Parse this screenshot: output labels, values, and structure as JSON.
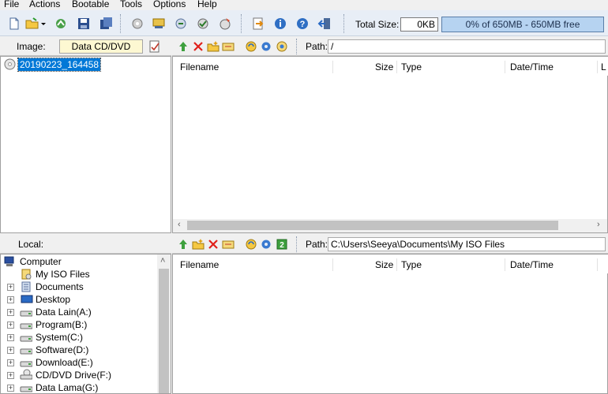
{
  "menu": [
    "File",
    "Actions",
    "Bootable",
    "Tools",
    "Options",
    "Help"
  ],
  "toolbar": {
    "total_size_label": "Total Size:",
    "total_size_value": "0KB",
    "capacity_text": "0% of 650MB - 650MB free",
    "capacity_used_fraction": 0.0
  },
  "image_pane": {
    "label": "Image:",
    "media_type": "Data CD/DVD",
    "root_item": "20190223_164458",
    "path_label": "Path:",
    "path_value": "/",
    "columns": [
      "Filename",
      "Size",
      "Type",
      "Date/Time",
      "L"
    ]
  },
  "local_pane": {
    "label": "Local:",
    "path_label": "Path:",
    "path_value": "C:\\Users\\Seeya\\Documents\\My ISO Files",
    "columns": [
      "Filename",
      "Size",
      "Type",
      "Date/Time"
    ],
    "tree": [
      {
        "label": "Computer",
        "icon": "computer-icon"
      },
      {
        "label": "My ISO Files",
        "icon": "folder-icon"
      },
      {
        "label": "Documents",
        "icon": "documents-icon"
      },
      {
        "label": "Desktop",
        "icon": "desktop-icon"
      },
      {
        "label": "Data Lain(A:)",
        "icon": "drive-icon"
      },
      {
        "label": "Program(B:)",
        "icon": "drive-icon"
      },
      {
        "label": "System(C:)",
        "icon": "drive-icon"
      },
      {
        "label": "Software(D:)",
        "icon": "drive-icon"
      },
      {
        "label": "Download(E:)",
        "icon": "drive-icon"
      },
      {
        "label": "CD/DVD Drive(F:)",
        "icon": "cd-drive-icon"
      },
      {
        "label": "Data Lama(G:)",
        "icon": "drive-icon"
      }
    ]
  },
  "colors": {
    "toolbar_bg": "#e8eef6",
    "selection": "#0078d7",
    "capacity_bar": "#b6d3f1"
  }
}
